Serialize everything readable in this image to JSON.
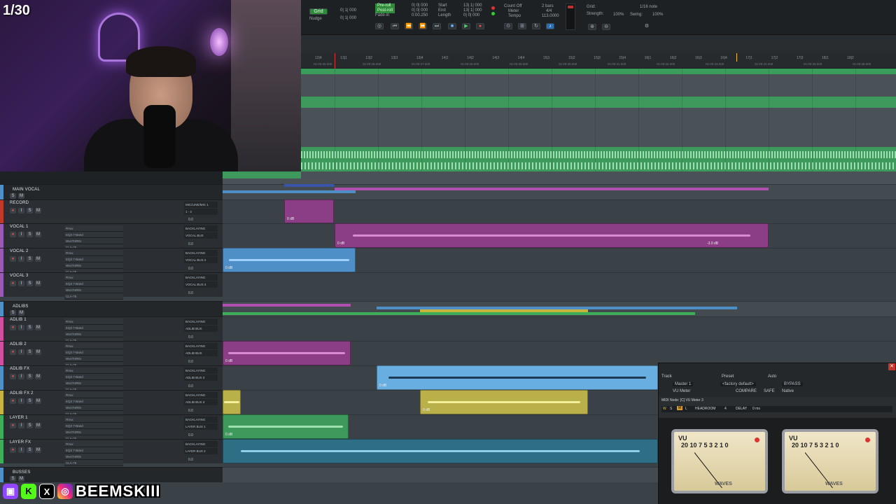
{
  "overlay": {
    "counter": "1/30",
    "handle": "BEEMSKIII",
    "socials": [
      "twitch-icon",
      "kick-icon",
      "x-icon",
      "instagram-icon"
    ]
  },
  "transport": {
    "grid_label": "Grid",
    "nudge_label": "Nudge",
    "grid_value": "0| 1| 000",
    "nudge_value": "0| 1| 000",
    "preroll": "Pre-roll",
    "postroll": "Post-roll",
    "fadein": "Fade-in",
    "preroll_val": "0| 0| 000",
    "postroll_val": "0| 0| 000",
    "fadein_val": "0:00.250",
    "start_label": "Start",
    "end_label": "End",
    "length_label": "Length",
    "start_val": "13| 1| 000",
    "end_val": "13| 1| 000",
    "length_val": "0| 0| 000",
    "count_off": "Count Off",
    "meter_label": "Meter",
    "tempo_label": "Tempo",
    "bars": "2 bars",
    "meter_val": "4/4",
    "tempo_val": "113.0000",
    "grid_right": "Grid:",
    "strength": "Strength:",
    "strength_val": "100%",
    "swing": "Swing:",
    "swing_val": "100%",
    "note": "1/16 note"
  },
  "ruler": {
    "bars": [
      "12|4",
      "13|1",
      "13|2",
      "13|3",
      "13|4",
      "14|1",
      "14|2",
      "14|3",
      "14|4",
      "15|1",
      "15|2",
      "15|3",
      "15|4",
      "16|1",
      "16|2",
      "16|3",
      "16|4",
      "17|1",
      "17|2",
      "17|3",
      "18|1",
      "18|2"
    ],
    "times": [
      "01:00:25.000",
      "01:00:26.000",
      "01:00:27.000",
      "01:00:28.000",
      "01:00:29.000",
      "01:00:30.000",
      "01:00:31.000",
      "01:00:32.000",
      "01:00:33.000",
      "01:00:34.000",
      "01:00:35.000",
      "01:00:36.000"
    ]
  },
  "tracks": [
    {
      "name": "MAIN VOCAL",
      "folder": true,
      "color": "#4f90c8"
    },
    {
      "name": "RECORD",
      "color": "#c0392b",
      "inserts": [],
      "io": [
        "MIC/LINE/MIC 1",
        "1 - 2"
      ],
      "vol": "0.0"
    },
    {
      "name": "VOCAL 1",
      "color": "#9b59b6",
      "inserts": [
        "RVox",
        "EQ3 7-Band",
        "WvsTnRtN",
        "CLA-76"
      ],
      "io": [
        "BACKLAYING",
        "VOCAL BUS"
      ],
      "vol": "0.0"
    },
    {
      "name": "VOCAL 2",
      "color": "#9b59b6",
      "inserts": [
        "RVox",
        "EQ3 7-Band",
        "WvsTnRtN",
        "CLA-76"
      ],
      "io": [
        "BACKLAYING",
        "VOCAL BUS 2"
      ],
      "vol": "0.0"
    },
    {
      "name": "VOCAL 3",
      "color": "#9b59b6",
      "inserts": [
        "RVox",
        "EQ3 7-Band",
        "WvsTnRtN",
        "CLA-76"
      ],
      "io": [
        "BACKLAYING",
        "VOCAL BUS 3"
      ],
      "vol": "0.0"
    },
    {
      "name": "ADLIBS",
      "folder": true,
      "color": "#4f90c8"
    },
    {
      "name": "ADLIB 1",
      "color": "#d24fa0",
      "inserts": [
        "RVox",
        "EQ3 7-Band",
        "WvsTnRtN",
        "CLA-76"
      ],
      "io": [
        "BACKLAYING",
        "ADLIB BUS"
      ],
      "vol": "0.0"
    },
    {
      "name": "ADLIB 2",
      "color": "#d24fa0",
      "inserts": [
        "RVox",
        "EQ3 7-Band",
        "WvsTnRtN",
        "CLA-76"
      ],
      "io": [
        "BACKLAYING",
        "ADLIB BUS"
      ],
      "vol": "0.0"
    },
    {
      "name": "ADLIB FX",
      "color": "#4f90c8",
      "inserts": [
        "RVox",
        "EQ3 7-Band",
        "WvsTnRtN",
        "CLA-76"
      ],
      "io": [
        "BACKLAYING",
        "ADLIB BUS 3"
      ],
      "vol": "0.0"
    },
    {
      "name": "ADLIB FX 2",
      "color": "#c8b43c",
      "inserts": [
        "RVox",
        "EQ3 7-Band",
        "WvsTnRtN",
        "CLA-76"
      ],
      "io": [
        "BACKLAYING",
        "ADLIB BUS 3"
      ],
      "vol": "0.0"
    },
    {
      "name": "LAYER 1",
      "color": "#3fae5a",
      "inserts": [
        "RVox",
        "EQ3 7-Band",
        "WvsTnRtN",
        "CLA-76"
      ],
      "io": [
        "BACKLAYING",
        "LAYER BUS 1"
      ],
      "vol": "0.0"
    },
    {
      "name": "LAYER FX",
      "color": "#3fae5a",
      "inserts": [
        "RVox",
        "EQ3 7-Band",
        "WvsTnRtN",
        "CLA-76"
      ],
      "io": [
        "BACKLAYING",
        "LAYER BUS 2"
      ],
      "vol": "0.0"
    },
    {
      "name": "BUSSES",
      "folder": true,
      "color": "#4f90c8"
    }
  ],
  "clips": {
    "record_gain": "0 dB",
    "vocal1_gain": "0 dB",
    "vocal1_end": "-3.0 dB",
    "vocal2_gain": "0 dB",
    "adlib2_gain": "0 dB",
    "adlibfx_gain": "0 dB",
    "adlibfx2_gain": "0 dB",
    "layer1_gain": "0 dB"
  },
  "plugin": {
    "track_label": "Track",
    "preset_label": "Preset",
    "auto_label": "Auto",
    "track_val": "Master 1",
    "preset_val": "<factory default>",
    "insert_val": "VU Meter",
    "bypass": "BYPASS",
    "compare": "COMPARE",
    "safe": "SAFE",
    "native": "Native",
    "node": "MIDI Node: [C] VU Meter 3",
    "headroom": "HEADROOM",
    "headroom_val": "4",
    "delay": "DELAY",
    "delay_val": "0 ms",
    "vu_label": "VU",
    "vu_scale": "20 10 7 5 3 2 1 0",
    "brand": "WAVES"
  },
  "colors": {
    "green_clip": "#3d9a5c",
    "purple_clip": "#8b3d86",
    "blue_clip": "#4f8fc8",
    "yellow_clip": "#b9b04a",
    "light_blue_clip": "#69aee0"
  }
}
